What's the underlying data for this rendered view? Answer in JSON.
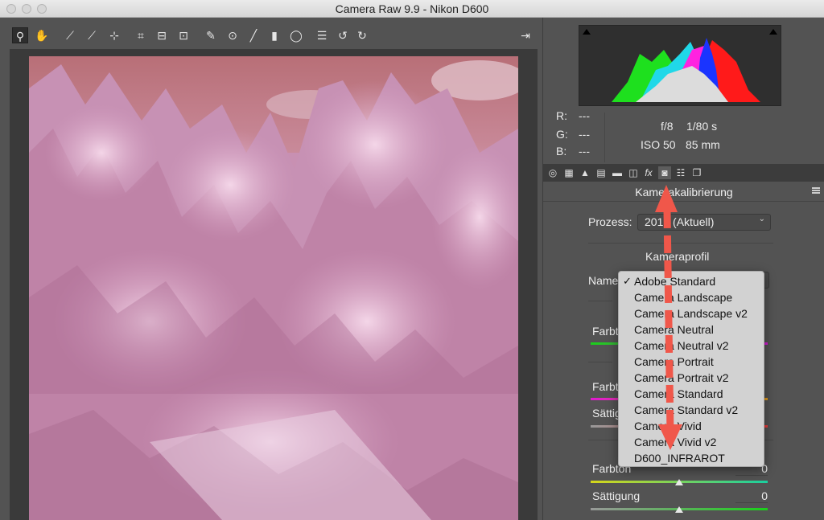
{
  "window": {
    "title": "Camera Raw 9.9 - Nikon D600"
  },
  "toolbar": {
    "tools": [
      {
        "name": "zoom-tool-icon",
        "glyph": "⚲"
      },
      {
        "name": "hand-tool-icon",
        "glyph": "✋"
      },
      {
        "name": "white-balance-tool-icon",
        "glyph": "⟋"
      },
      {
        "name": "color-sampler-tool-icon",
        "glyph": "⟋"
      },
      {
        "name": "targeted-adjustment-tool-icon",
        "glyph": "⊹"
      },
      {
        "name": "crop-tool-icon",
        "glyph": "⌗"
      },
      {
        "name": "straighten-tool-icon",
        "glyph": "⊟"
      },
      {
        "name": "transform-tool-icon",
        "glyph": "⊡"
      },
      {
        "name": "spot-removal-tool-icon",
        "glyph": "✎"
      },
      {
        "name": "red-eye-tool-icon",
        "glyph": "⊙"
      },
      {
        "name": "adjustment-brush-icon",
        "glyph": "╱"
      },
      {
        "name": "graduated-filter-icon",
        "glyph": "▮"
      },
      {
        "name": "radial-filter-icon",
        "glyph": "◯"
      },
      {
        "name": "preferences-icon",
        "glyph": "☰"
      },
      {
        "name": "rotate-left-icon",
        "glyph": "↺"
      },
      {
        "name": "rotate-right-icon",
        "glyph": "↻"
      }
    ],
    "export_glyph": "⇥"
  },
  "info": {
    "r_label": "R:",
    "g_label": "G:",
    "b_label": "B:",
    "r_value": "---",
    "g_value": "---",
    "b_value": "---",
    "aperture": "f/8",
    "shutter": "1/80 s",
    "iso": "ISO 50",
    "focal": "85 mm"
  },
  "tabs": {
    "fx_label": "fx"
  },
  "panel": {
    "title": "Kamerakalibrierung",
    "process_label": "Prozess:",
    "process_value": "2012 (Aktuell)",
    "profile_heading": "Kameraprofil",
    "name_label": "Name:",
    "hue_label_1": "Farbton",
    "hue_label_2": "Farbton",
    "sat_label_2": "Sättigung",
    "hue_label_3": "Farbton",
    "sat_label_3": "Sättigung",
    "hue_value_3": "0",
    "sat_value_3": "0"
  },
  "profile_menu": {
    "check_glyph": "✓",
    "items": [
      "Adobe Standard",
      "Camera Landscape",
      "Camera Landscape v2",
      "Camera Neutral",
      "Camera Neutral v2",
      "Camera Portrait",
      "Camera Portrait v2",
      "Camera Standard",
      "Camera Standard v2",
      "Camera Vivid",
      "Camera Vivid v2",
      "D600_INFRAROT"
    ],
    "selected_index": 0
  },
  "colors": {
    "arrow": "#f0574a",
    "photo_base": "#c890b2",
    "sky": "#b86f77"
  }
}
